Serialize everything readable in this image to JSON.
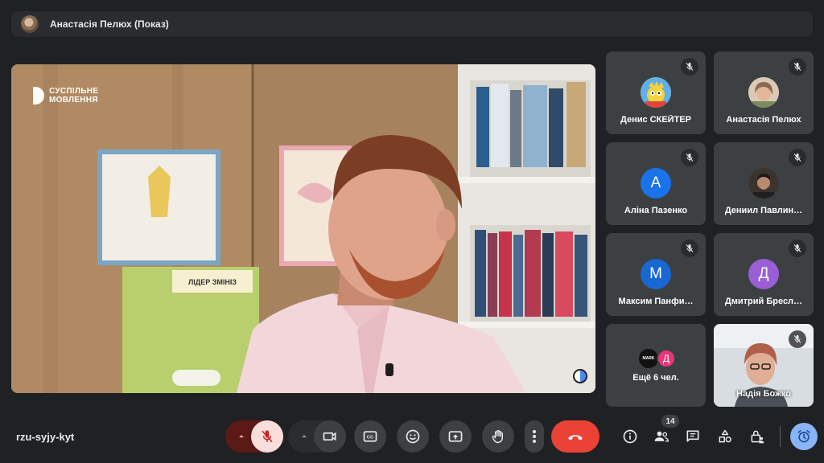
{
  "presenter_bar": {
    "title": "Анастасія Пелюх (Показ)"
  },
  "stage": {
    "logo_line1": "СУСПІЛЬНЕ",
    "logo_line2": "МОВЛЕННЯ",
    "poster_text": "ЛІДЕР ЗМІНІЗ"
  },
  "participants": [
    {
      "name": "Денис СКЕЙТЕР",
      "avatar": "cartoon-icon"
    },
    {
      "name": "Анастасія Пелюх",
      "avatar": "photo"
    },
    {
      "name": "Аліна Пазенко",
      "avatar_letter": "А",
      "color": "#1a73e8"
    },
    {
      "name": "Дениил Павлин…",
      "avatar": "photo"
    },
    {
      "name": "Максим Панфи…",
      "avatar_letter": "М",
      "color": "#1967d2"
    },
    {
      "name": "Дмитрий Бресл…",
      "avatar_letter": "Д",
      "color": "#9a5fd6"
    },
    {
      "name": "Надія Божко",
      "avatar": "video"
    }
  ],
  "more_tile": {
    "label": "Ещё 6 чел.",
    "small1": "MARK",
    "small2": "Д"
  },
  "bottom_bar": {
    "meeting_code": "rzu-syjy-kyt",
    "participants_count": "14"
  },
  "colors": {
    "background": "#202124",
    "tile": "#3c4043",
    "end_call": "#ea4335",
    "mic_off_bg": "#f9dedc",
    "mic_off_icon": "#c5221f",
    "activity_accent": "#8ab4f8"
  }
}
